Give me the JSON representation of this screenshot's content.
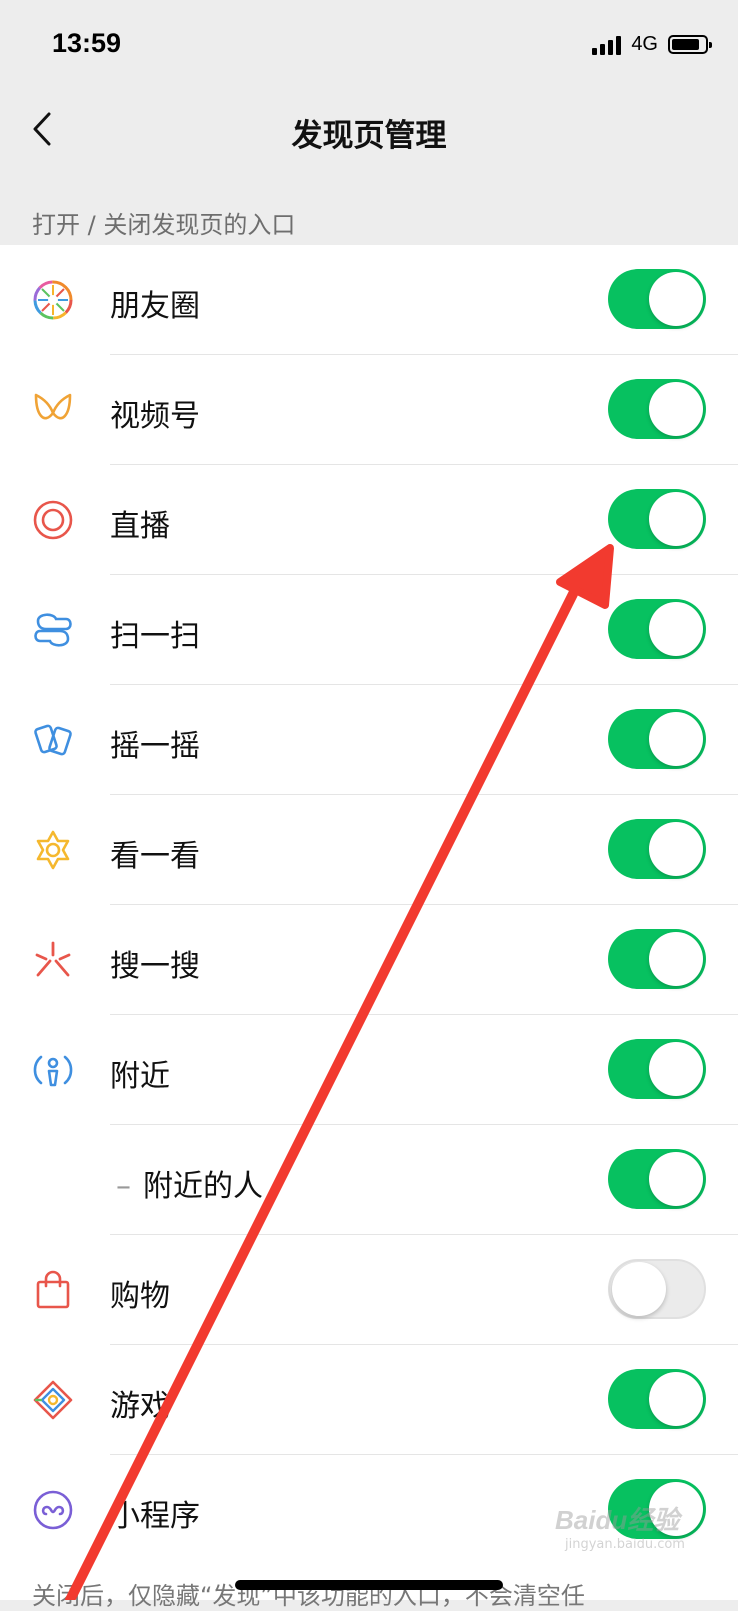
{
  "status_bar": {
    "time": "13:59",
    "network": "4G"
  },
  "nav": {
    "title": "发现页管理"
  },
  "section_header": "打开 / 关闭发现页的入口",
  "items": [
    {
      "label": "朋友圈",
      "icon": "moments-icon",
      "enabled": true
    },
    {
      "label": "视频号",
      "icon": "channels-icon",
      "enabled": true
    },
    {
      "label": "直播",
      "icon": "live-icon",
      "enabled": true
    },
    {
      "label": "扫一扫",
      "icon": "scan-icon",
      "enabled": true
    },
    {
      "label": "摇一摇",
      "icon": "shake-icon",
      "enabled": true
    },
    {
      "label": "看一看",
      "icon": "top-stories-icon",
      "enabled": true
    },
    {
      "label": "搜一搜",
      "icon": "search-icon",
      "enabled": true
    },
    {
      "label": "附近",
      "icon": "nearby-icon",
      "enabled": true
    },
    {
      "label": "附近的人",
      "icon": "",
      "enabled": true
    },
    {
      "label": "购物",
      "icon": "shopping-bag-icon",
      "enabled": false
    },
    {
      "label": "游戏",
      "icon": "games-icon",
      "enabled": true
    },
    {
      "label": "小程序",
      "icon": "mini-programs-icon",
      "enabled": true
    }
  ],
  "footer_note": "关闭后，仅隐藏“发现”中该功能的入口，不会清空任",
  "watermark": {
    "logo": "Baidu经验",
    "sub": "jingyan.baidu.com"
  },
  "colors": {
    "toggle_on": "#07c160",
    "annotation_arrow": "#f23a2f"
  }
}
